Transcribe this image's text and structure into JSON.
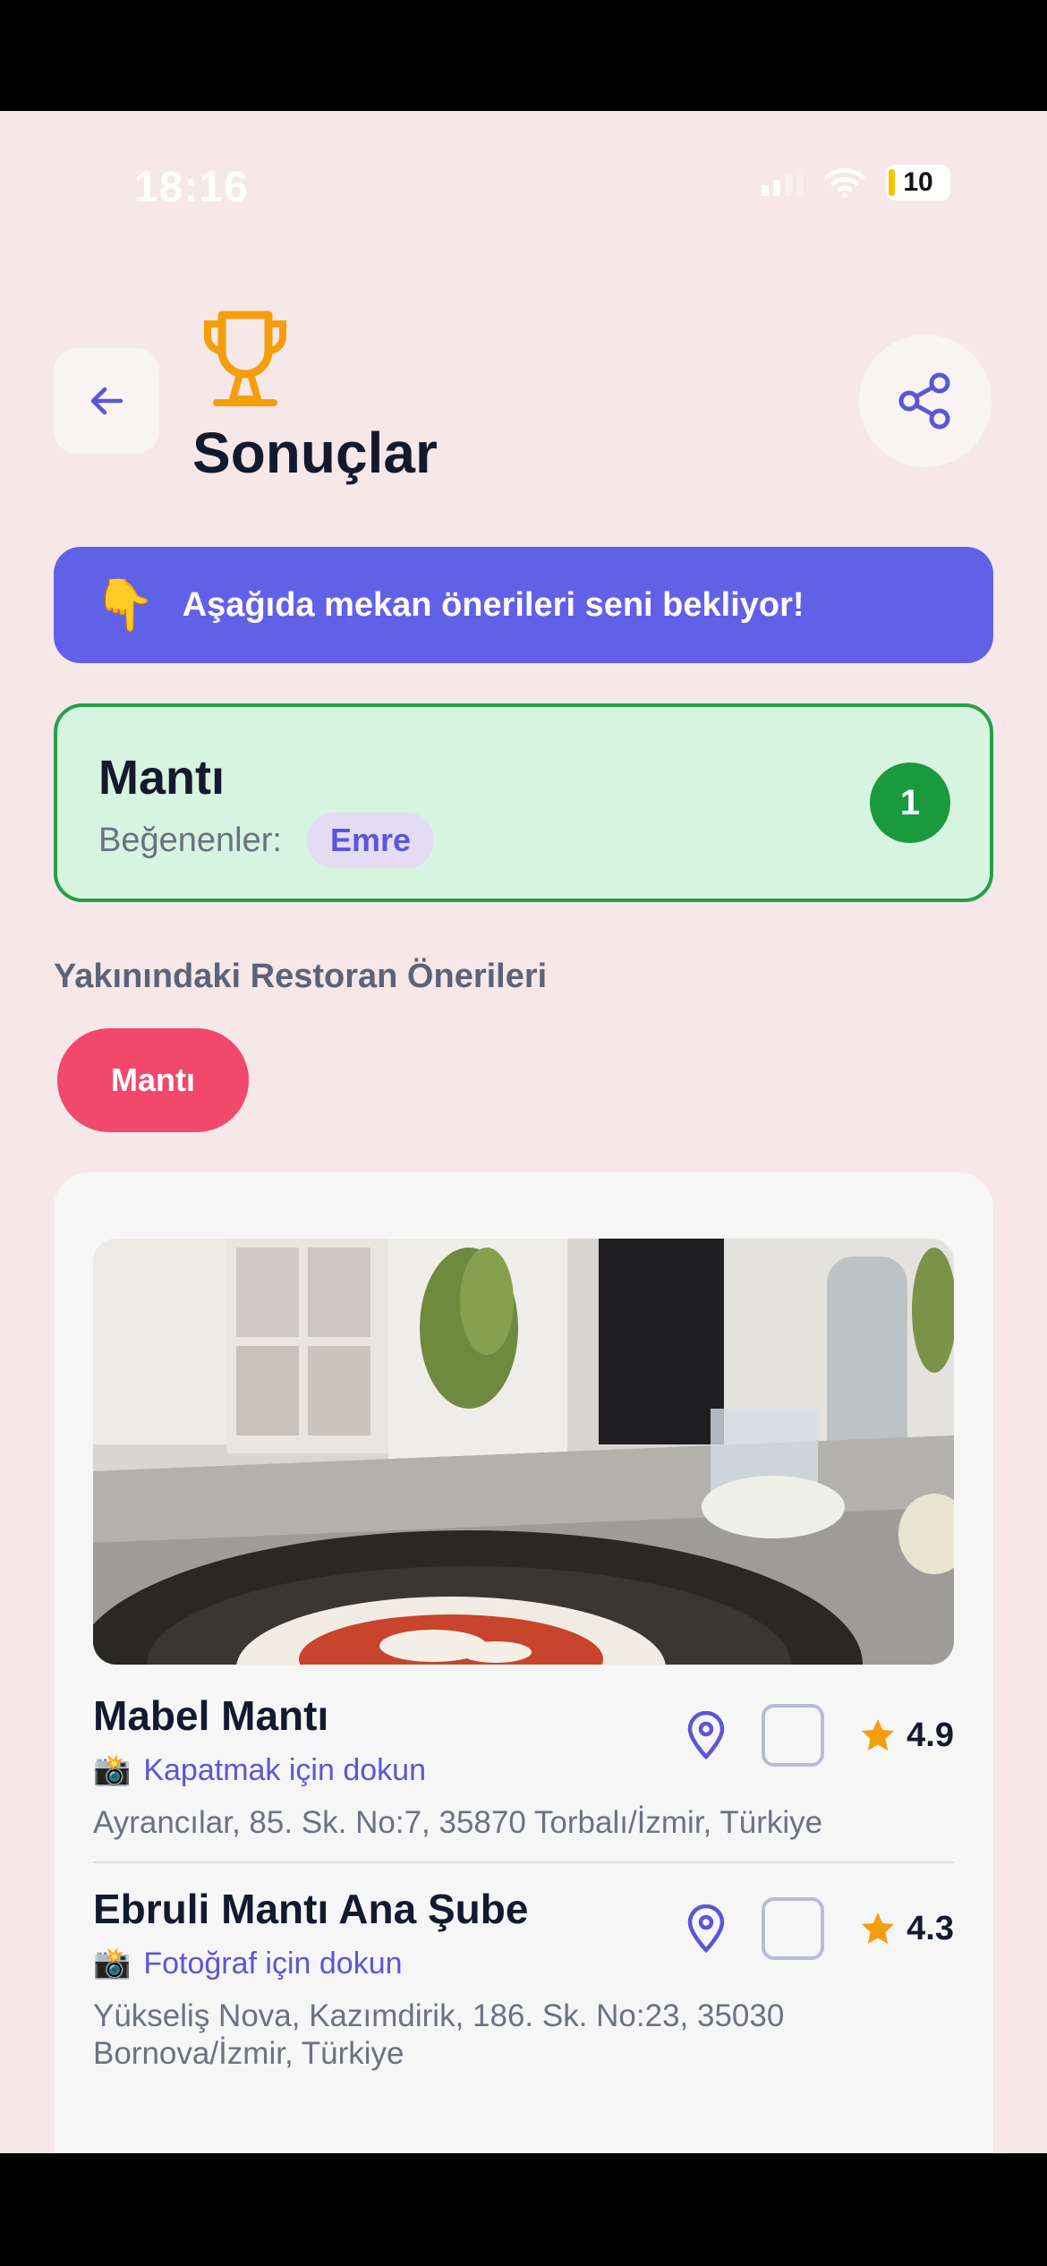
{
  "status_bar": {
    "time": "18:16",
    "battery": "10"
  },
  "header": {
    "title": "Sonuçlar"
  },
  "banner": {
    "emoji": "👇",
    "text": "Aşağıda mekan önerileri seni bekliyor!"
  },
  "winner": {
    "name": "Mantı",
    "liked_label": "Beğenenler:",
    "likers": [
      "Emre"
    ],
    "rank": "1"
  },
  "section_title": "Yakınındaki Restoran Önerileri",
  "filter_chip": "Mantı",
  "restaurants": [
    {
      "name": "Mabel Mantı",
      "hint_emoji": "📸",
      "hint": "Kapatmak için dokun",
      "address": "Ayrancılar, 85. Sk. No:7, 35870 Torbalı/İzmir, Türkiye",
      "rating": "4.9"
    },
    {
      "name": "Ebruli Mantı Ana Şube",
      "hint_emoji": "📸",
      "hint": "Fotoğraf için dokun",
      "address": "Yükseliş Nova, Kazımdirik, 186. Sk. No:23, 35030 Bornova/İzmir, Türkiye",
      "rating": "4.3"
    }
  ],
  "colors": {
    "accent": "#6161e8",
    "success": "#1a9a3e",
    "chip": "#f2486b",
    "star": "#f59e0b",
    "background": "#f6e7e8"
  }
}
